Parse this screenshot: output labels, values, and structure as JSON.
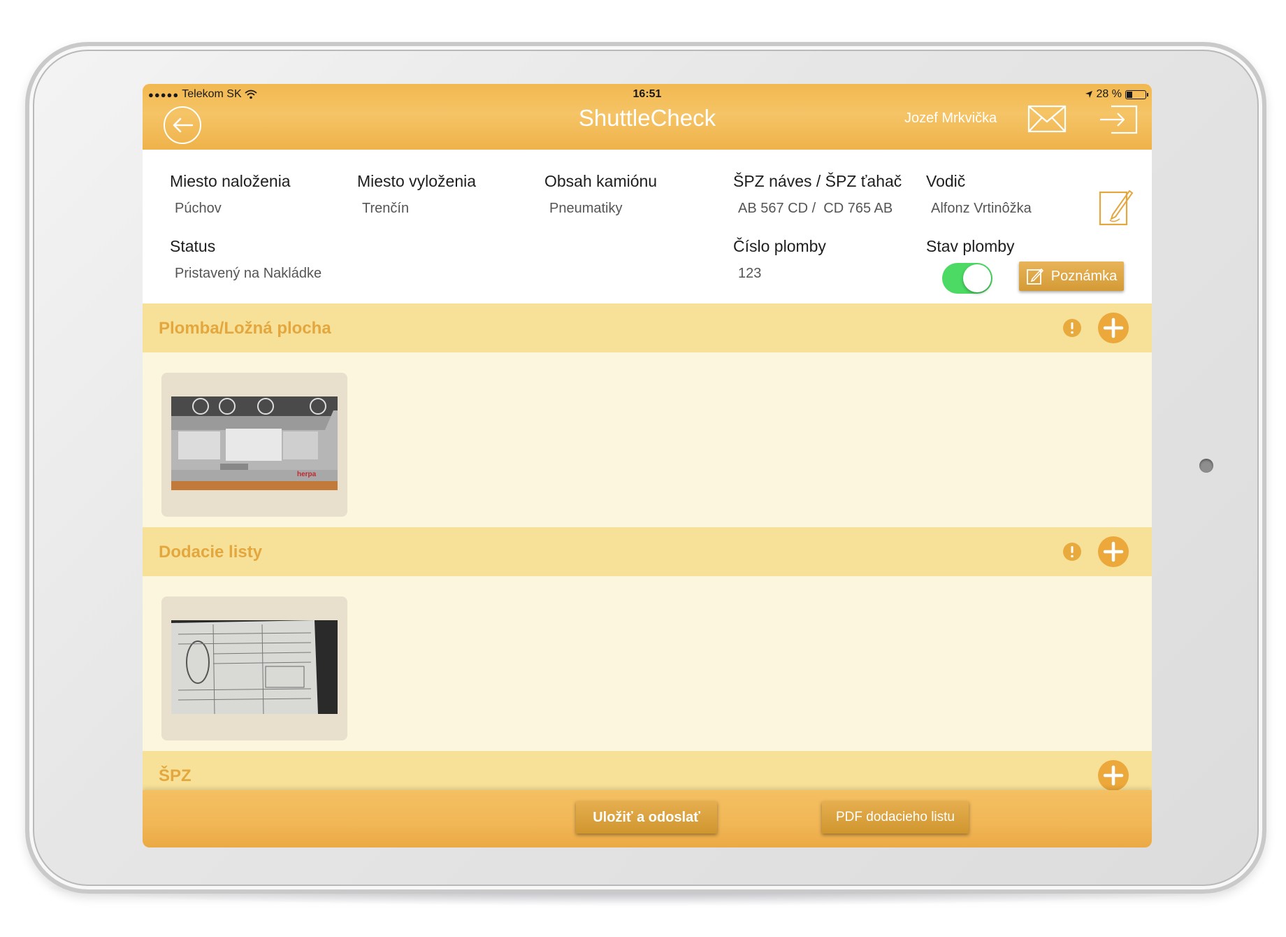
{
  "status_bar": {
    "carrier": "Telekom SK",
    "time": "16:51",
    "battery": "28 %",
    "battery_level": 0.28
  },
  "header": {
    "title": "ShuttleCheck",
    "user": "Jozef Mrkvička"
  },
  "info": {
    "loading_place": {
      "label": "Miesto naloženia",
      "value": "Púchov"
    },
    "unloading_place": {
      "label": "Miesto vyloženia",
      "value": "Trenčín"
    },
    "truck_content": {
      "label": "Obsah kamiónu",
      "value": "Pneumatiky"
    },
    "plates": {
      "label": "ŠPZ náves / ŠPZ ťahač",
      "value": "AB 567 CD /  CD 765 AB"
    },
    "driver": {
      "label": "Vodič",
      "value": "Alfonz Vrtinôžka"
    },
    "status": {
      "label": "Status",
      "value": "Pristavený na Nakládke"
    },
    "seal_number": {
      "label": "Číslo plomby",
      "value": "123"
    },
    "seal_state": {
      "label": "Stav plomby",
      "on": true
    },
    "note_button": "Poznámka"
  },
  "sections": [
    {
      "title": "Plomba/Ložná plocha",
      "has_alert": true
    },
    {
      "title": "Dodacie listy",
      "has_alert": true
    },
    {
      "title": "ŠPZ",
      "has_alert": false
    }
  ],
  "footer": {
    "save_send": "Uložiť a odoslať",
    "pdf": "PDF dodacieho listu"
  },
  "colors": {
    "bar": "#f2b850",
    "section_header": "#f7e199",
    "section_body": "#fdf6de",
    "section_title": "#e3a73e",
    "toggle_on": "#4cd964"
  }
}
